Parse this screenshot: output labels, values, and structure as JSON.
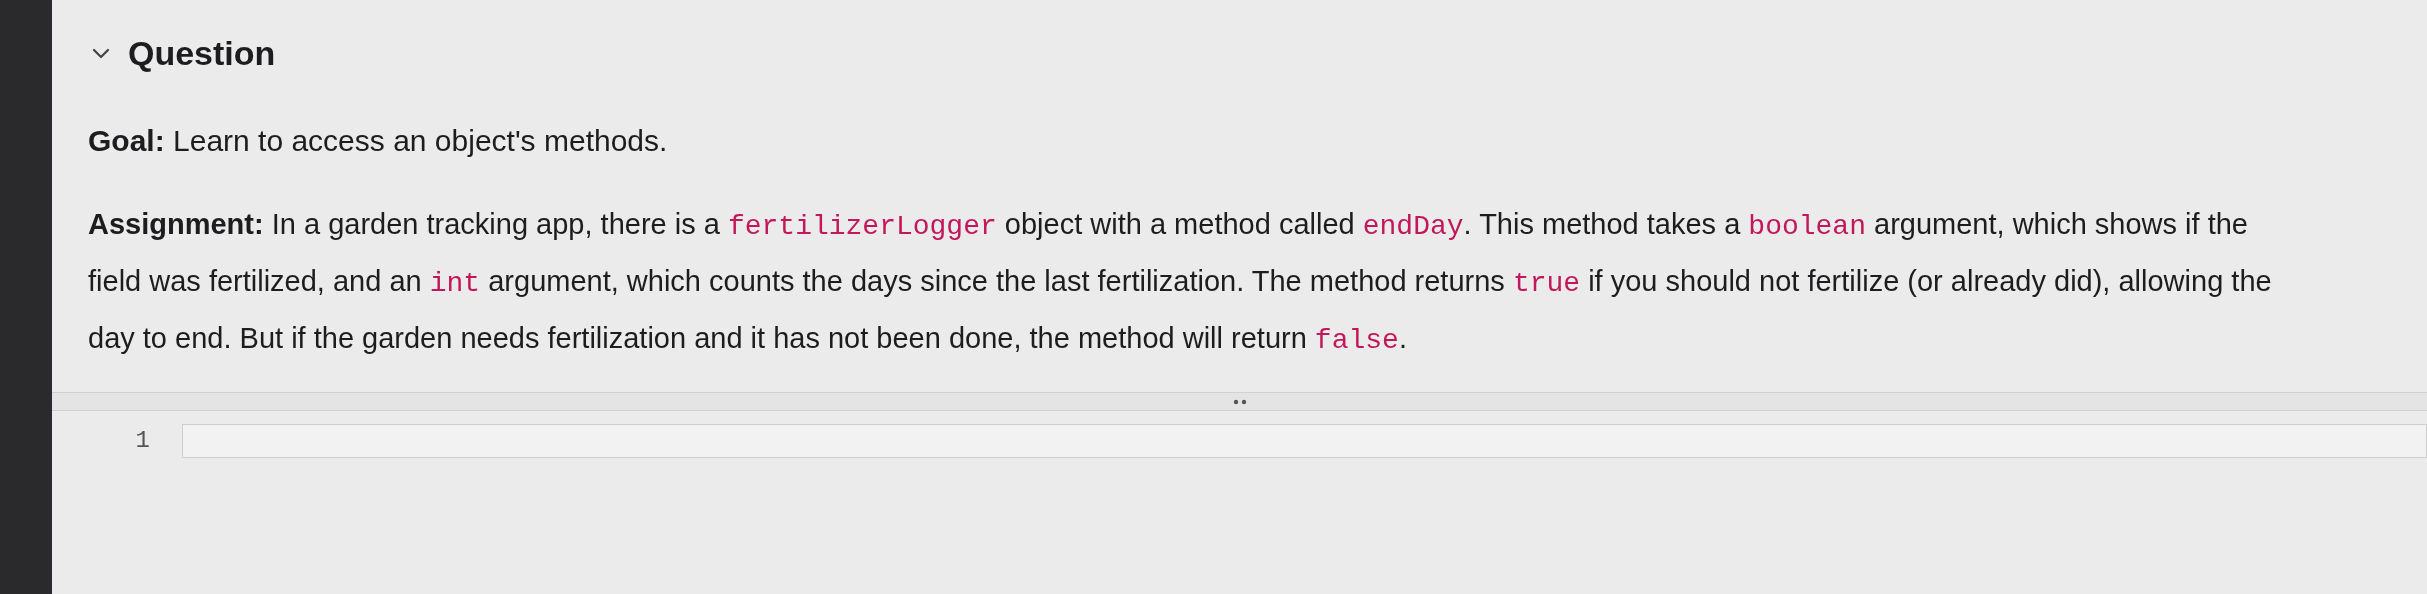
{
  "section": {
    "title": "Question",
    "expanded": true
  },
  "goal": {
    "label": "Goal:",
    "text": "Learn to access an object's methods."
  },
  "assignment": {
    "label": "Assignment:",
    "segments": [
      {
        "kind": "text",
        "text": " In a garden tracking app, there is a "
      },
      {
        "kind": "code",
        "text": "fertilizerLogger"
      },
      {
        "kind": "text",
        "text": " object with a method called "
      },
      {
        "kind": "code",
        "text": "endDay"
      },
      {
        "kind": "text",
        "text": ". This method takes a "
      },
      {
        "kind": "code",
        "text": "boolean"
      },
      {
        "kind": "text",
        "text": " argument, which shows if the field was fertilized, and an "
      },
      {
        "kind": "code",
        "text": "int"
      },
      {
        "kind": "text",
        "text": " argument, which counts the days since the last fertilization. The method returns "
      },
      {
        "kind": "code",
        "text": "true"
      },
      {
        "kind": "text",
        "text": " if you should not fertilize (or already did), allowing the day to end. But if the garden needs fertilization and it has not been done, the method will return "
      },
      {
        "kind": "code",
        "text": "false"
      },
      {
        "kind": "text",
        "text": "."
      }
    ]
  },
  "editor": {
    "lines": [
      {
        "number": "1"
      }
    ]
  }
}
